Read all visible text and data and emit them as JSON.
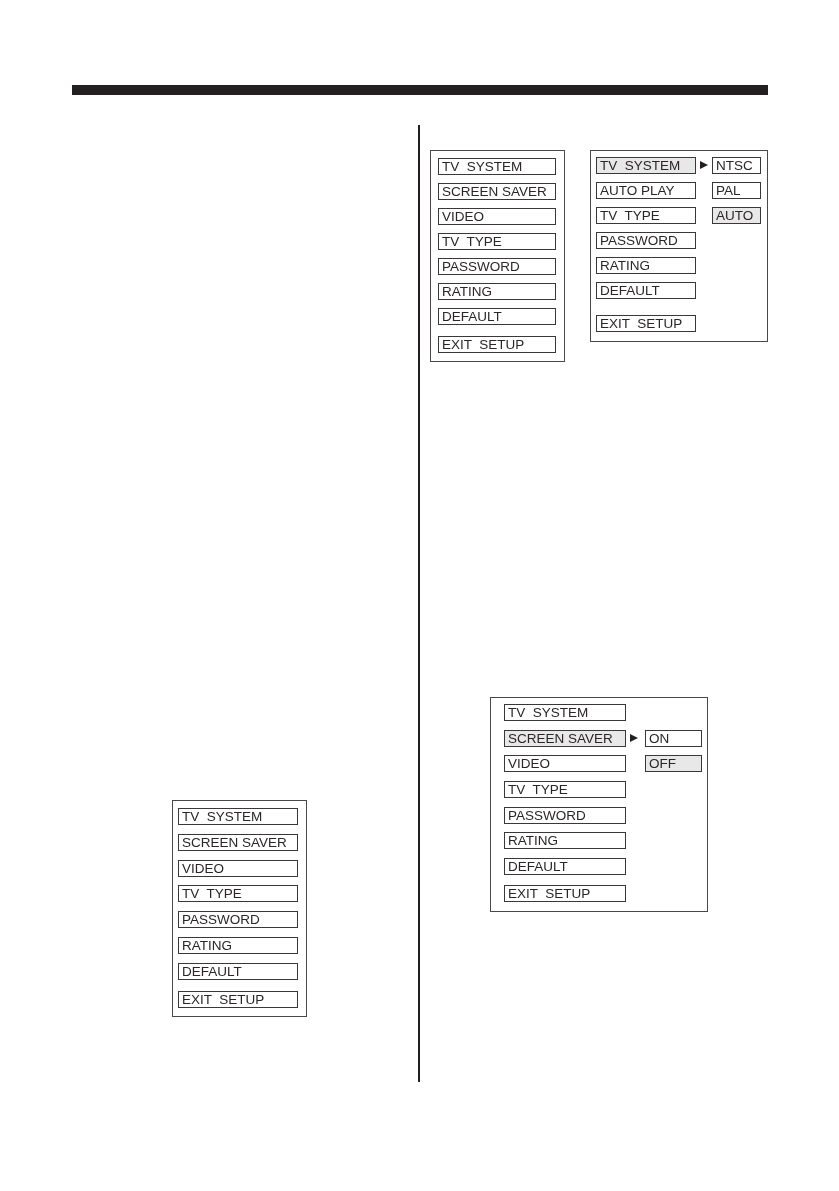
{
  "left_column": {
    "menus": [
      {
        "items": [
          {
            "label": "TV  SYSTEM",
            "selected": false
          },
          {
            "label": "SCREEN SAVER",
            "selected": false
          },
          {
            "label": "VIDEO",
            "selected": false
          },
          {
            "label": "TV  TYPE",
            "selected": false
          },
          {
            "label": "PASSWORD",
            "selected": false
          },
          {
            "label": "RATING",
            "selected": false
          },
          {
            "label": "DEFAULT",
            "selected": false
          },
          {
            "label": "EXIT  SETUP",
            "selected": false
          }
        ]
      }
    ]
  },
  "right_column": {
    "menus": [
      {
        "items": [
          {
            "label": "TV  SYSTEM",
            "selected": false
          },
          {
            "label": "SCREEN SAVER",
            "selected": false
          },
          {
            "label": "VIDEO",
            "selected": false
          },
          {
            "label": "TV  TYPE",
            "selected": false
          },
          {
            "label": "PASSWORD",
            "selected": false
          },
          {
            "label": "RATING",
            "selected": false
          },
          {
            "label": "DEFAULT",
            "selected": false
          },
          {
            "label": "EXIT  SETUP",
            "selected": false
          }
        ]
      },
      {
        "items": [
          {
            "label": "TV  SYSTEM",
            "selected": true
          },
          {
            "label": "AUTO PLAY",
            "selected": false
          },
          {
            "label": "TV  TYPE",
            "selected": false
          },
          {
            "label": "PASSWORD",
            "selected": false
          },
          {
            "label": "RATING",
            "selected": false
          },
          {
            "label": "DEFAULT",
            "selected": false
          },
          {
            "label": "EXIT  SETUP",
            "selected": false
          }
        ],
        "submenu": [
          {
            "label": "NTSC",
            "selected": false
          },
          {
            "label": "PAL",
            "selected": false
          },
          {
            "label": "AUTO",
            "selected": true
          }
        ]
      },
      {
        "items": [
          {
            "label": "TV  SYSTEM",
            "selected": false
          },
          {
            "label": "SCREEN SAVER",
            "selected": true
          },
          {
            "label": "VIDEO",
            "selected": false
          },
          {
            "label": "TV  TYPE",
            "selected": false
          },
          {
            "label": "PASSWORD",
            "selected": false
          },
          {
            "label": "RATING",
            "selected": false
          },
          {
            "label": "DEFAULT",
            "selected": false
          },
          {
            "label": "EXIT  SETUP",
            "selected": false
          }
        ],
        "submenu": [
          {
            "label": "ON",
            "selected": false
          },
          {
            "label": "OFF",
            "selected": true
          }
        ]
      }
    ]
  }
}
